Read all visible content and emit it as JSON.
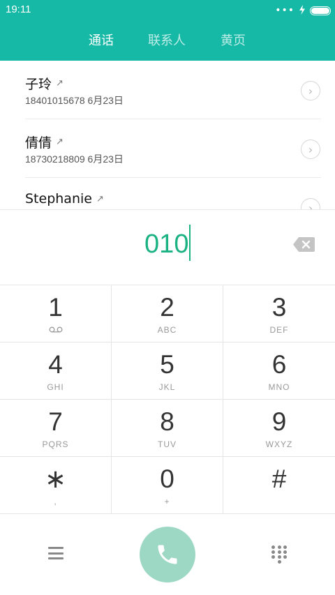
{
  "status_bar": {
    "time": "19:11",
    "dots": "•••",
    "battery_level": 1.0
  },
  "tabs": [
    {
      "label": "通话",
      "active": true
    },
    {
      "label": "联系人",
      "active": false
    },
    {
      "label": "黄页",
      "active": false
    }
  ],
  "call_log": [
    {
      "name": "子玲",
      "number": "18401015678",
      "date": "6月23日"
    },
    {
      "name": "倩倩",
      "number": "18730218809",
      "date": "6月23日"
    },
    {
      "name": "Stephanie",
      "number": "",
      "date": ""
    }
  ],
  "dialer": {
    "input_value": "010"
  },
  "keypad": [
    {
      "digit": "1",
      "letters": "",
      "icon": "voicemail-icon"
    },
    {
      "digit": "2",
      "letters": "ABC"
    },
    {
      "digit": "3",
      "letters": "DEF"
    },
    {
      "digit": "4",
      "letters": "GHI"
    },
    {
      "digit": "5",
      "letters": "JKL"
    },
    {
      "digit": "6",
      "letters": "MNO"
    },
    {
      "digit": "7",
      "letters": "PQRS"
    },
    {
      "digit": "8",
      "letters": "TUV"
    },
    {
      "digit": "9",
      "letters": "WXYZ"
    },
    {
      "digit": "∗",
      "letters": ","
    },
    {
      "digit": "0",
      "letters": "+"
    },
    {
      "digit": "#",
      "letters": ""
    }
  ],
  "icons": {
    "call_log_arrow": "↗",
    "info": "›",
    "backspace": "backspace-icon",
    "menu": "menu-icon",
    "call": "phone-icon",
    "dialpad": "dialpad-icon"
  },
  "colors": {
    "header": "#16b9a6",
    "dialed_text": "#1bb283",
    "call_button": "#9dd8c5"
  }
}
